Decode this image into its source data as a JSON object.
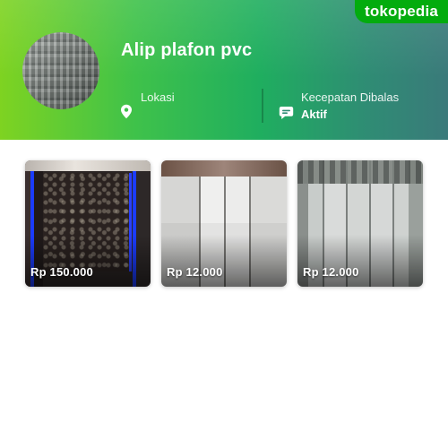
{
  "brand": {
    "name": "tokopedia",
    "color": "#03ac0e"
  },
  "shop": {
    "name": "Alip plafon pvc",
    "location_label": "Lokasi",
    "location_icon": "location-pin-icon",
    "response_label": "Kecepatan Dibalas",
    "response_value": "Aktif",
    "response_icon": "chat-bubble-icon"
  },
  "products": [
    {
      "price": "Rp 150.000"
    },
    {
      "price": "Rp 12.000"
    },
    {
      "price": "Rp 12.000"
    }
  ]
}
